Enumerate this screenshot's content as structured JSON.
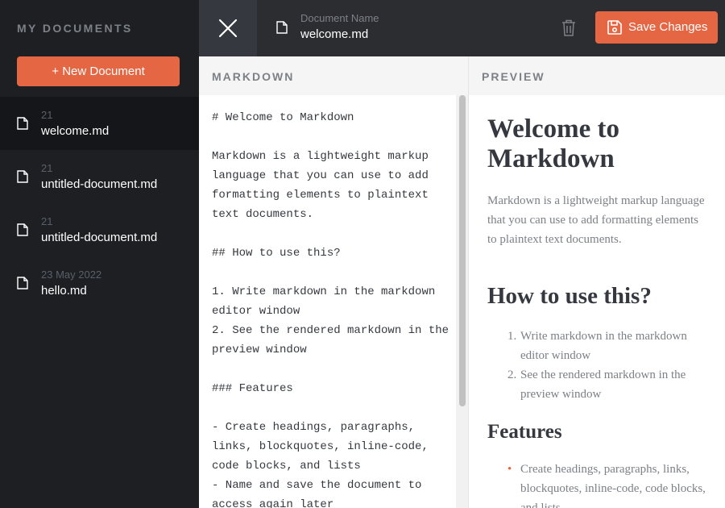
{
  "sidebar": {
    "title": "MY DOCUMENTS",
    "new_document_label": "+ New Document",
    "documents": [
      {
        "date": "21",
        "name": "welcome.md",
        "active": true
      },
      {
        "date": "21",
        "name": "untitled-document.md",
        "active": false
      },
      {
        "date": "21",
        "name": "untitled-document.md",
        "active": false
      },
      {
        "date": "23 May 2022",
        "name": "hello.md",
        "active": false
      }
    ]
  },
  "header": {
    "document_label": "Document Name",
    "document_name": "welcome.md",
    "save_label": "Save Changes"
  },
  "panels": {
    "markdown_label": "MARKDOWN",
    "preview_label": "PREVIEW"
  },
  "editor": {
    "content": "# Welcome to Markdown\n\nMarkdown is a lightweight markup language that you can use to add formatting elements to plaintext text documents.\n\n## How to use this?\n\n1. Write markdown in the markdown editor window\n2. See the rendered markdown in the preview window\n\n### Features\n\n- Create headings, paragraphs, links, blockquotes, inline-code, code blocks, and lists\n- Name and save the document to access again later"
  },
  "preview": {
    "h1": "Welcome to Markdown",
    "paragraph": "Markdown is a lightweight markup language that you can use to add formatting elements to plaintext text documents.",
    "h2": "How to use this?",
    "ordered_list": [
      {
        "num": "1.",
        "text": "Write markdown in the markdown editor window"
      },
      {
        "num": "2.",
        "text": "See the rendered markdown in the preview window"
      }
    ],
    "h3": "Features",
    "unordered_list": [
      {
        "bullet": "•",
        "text": "Create headings, paragraphs, links, blockquotes, inline-code, code blocks, and lists"
      }
    ]
  },
  "colors": {
    "accent": "#e46643",
    "sidebar_bg": "#1d1f22",
    "header_bg": "#2b2d31"
  },
  "icons": {
    "close": "close-icon",
    "file": "file-icon",
    "delete": "trash-icon",
    "save": "save-icon"
  }
}
